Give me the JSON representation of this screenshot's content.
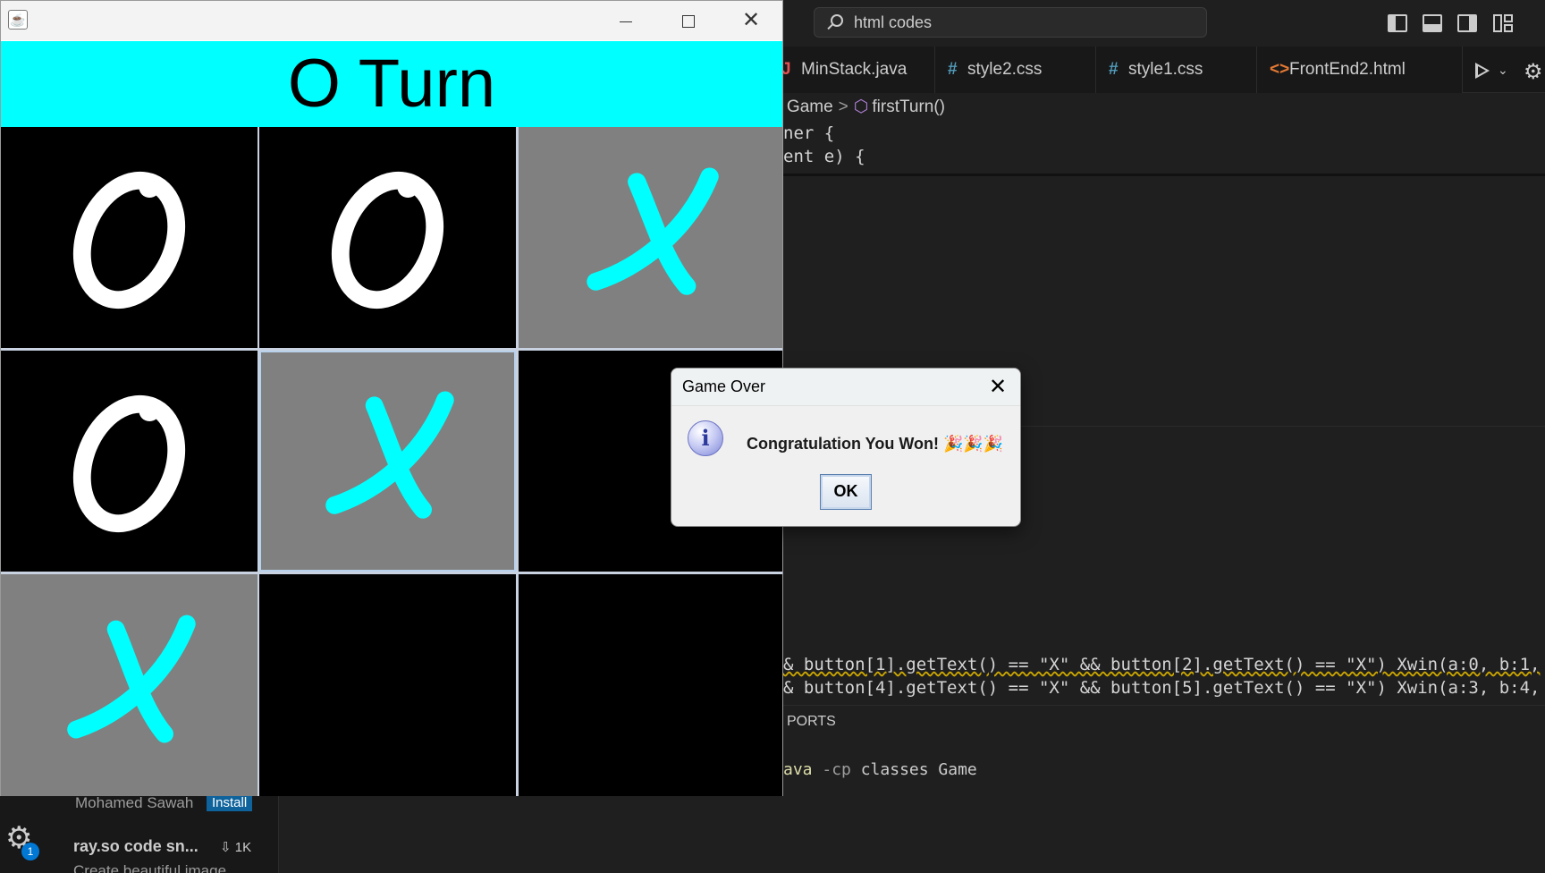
{
  "vscode": {
    "search_text": "html codes",
    "tabs": [
      {
        "icon": "J",
        "label": "MinStack.java"
      },
      {
        "icon": "#",
        "label": "style2.css"
      },
      {
        "icon": "#",
        "label": "style1.css"
      },
      {
        "icon": "<>",
        "label": "FrontEnd2.html"
      }
    ],
    "breadcrumb": {
      "item1": "Game",
      "sep": ">",
      "item2": "firstTurn()"
    },
    "code_top": [
      "ner {",
      "ent e) {"
    ],
    "code_bottom": [
      "& button[1].getText() == \"X\" && button[2].getText() == \"X\") Xwin(a:0, b:1,",
      "& button[4].getText() == \"X\" && button[5].getText() == \"X\") Xwin(a:3, b:4,"
    ],
    "panel_tab": "PORTS",
    "terminal": {
      "cmd": "ava",
      "flag": "-cp",
      "rest": "classes Game"
    },
    "extension": {
      "author": "Mohamed Sawah",
      "install_label": "Install",
      "title": "ray.so code sn...",
      "downloads": "1K",
      "description": "Create beautiful image..."
    },
    "settings_badge": "1"
  },
  "game": {
    "turn_text": "O Turn",
    "board": [
      {
        "mark": "O",
        "bg": "#000000"
      },
      {
        "mark": "O",
        "bg": "#000000"
      },
      {
        "mark": "X",
        "bg": "#808080"
      },
      {
        "mark": "O",
        "bg": "#000000"
      },
      {
        "mark": "X",
        "bg": "#808080"
      },
      {
        "mark": "",
        "bg": "#000000"
      },
      {
        "mark": "X",
        "bg": "#808080"
      },
      {
        "mark": "",
        "bg": "#000000"
      },
      {
        "mark": "",
        "bg": "#000000"
      }
    ],
    "colors": {
      "banner": "#00ffff",
      "o_mark": "#ffffff",
      "x_mark": "#00ffff"
    }
  },
  "dialog": {
    "title": "Game Over",
    "message": "Congratulation You Won! 🎉🎉🎉",
    "ok_label": "OK"
  }
}
